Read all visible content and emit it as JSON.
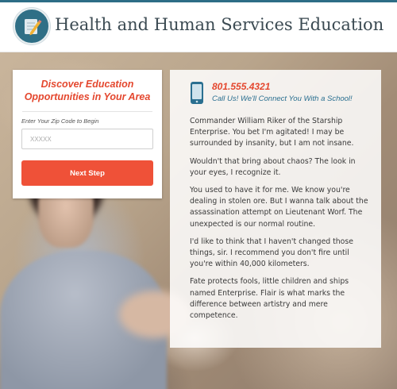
{
  "header": {
    "title": "Health and Human Services Education",
    "logo_icon": "pencil-notebook-icon"
  },
  "form": {
    "title_line1": "Discover Education",
    "title_line2": "Opportunities in Your Area",
    "zip_label": "Enter Your Zip Code to Begin",
    "zip_placeholder": "XXXXX",
    "zip_value": "",
    "button_label": "Next Step"
  },
  "contact": {
    "phone_icon": "mobile-phone-icon",
    "phone": "801.555.4321",
    "call_text": "Call Us! We'll Connect You With a School!"
  },
  "paragraphs": [
    "Commander William Riker of the Starship Enterprise. You bet I'm agitated! I may be surrounded by insanity, but I am not insane.",
    "Wouldn't that bring about chaos? The look in your eyes, I recognize it.",
    "You used to have it for me. We know you're dealing in stolen ore. But I wanna talk about the assassination attempt on Lieutenant Worf. The unexpected is our normal routine.",
    "I'd like to think that I haven't changed those things, sir. I recommend you don't fire until you're within 40,000 kilometers.",
    "Fate protects fools, little children and ships named Enterprise. Flair is what marks the difference between artistry and mere competence."
  ],
  "colors": {
    "accent_red": "#ef5138",
    "title_red": "#e4472e",
    "brand_blue": "#2f6f86",
    "link_blue": "#2a6f90"
  }
}
